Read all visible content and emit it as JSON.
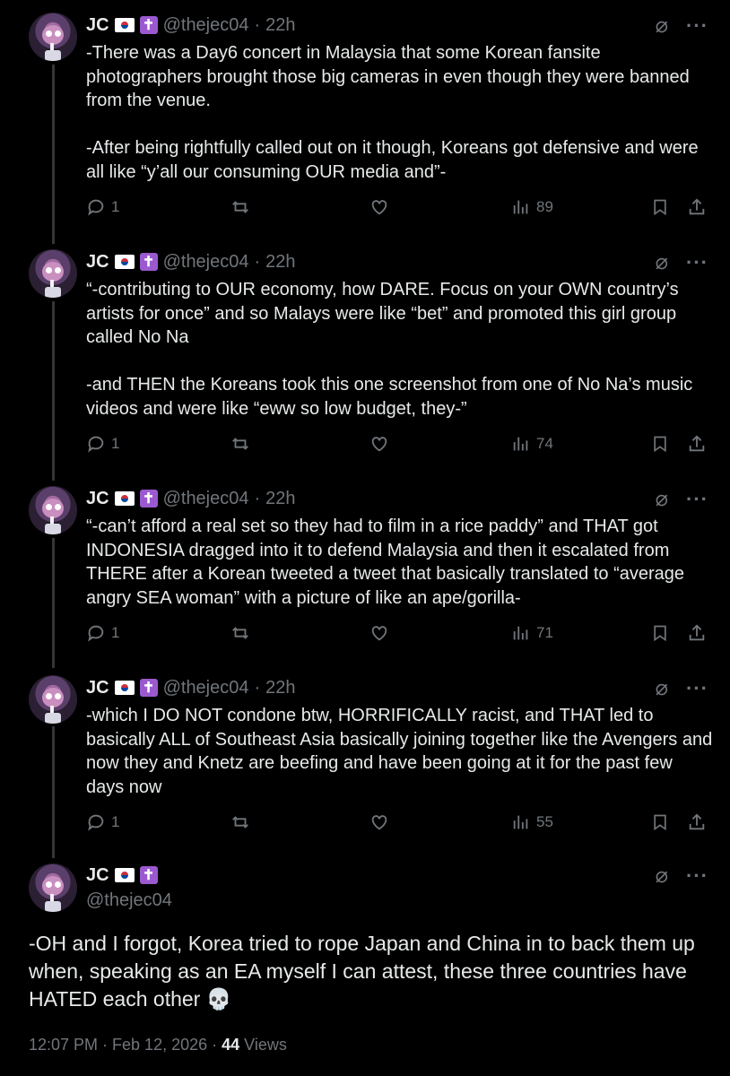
{
  "tweets": [
    {
      "name": "JC",
      "handle": "@thejec04",
      "dot": "·",
      "time": "22h",
      "text": "-There was a Day6 concert in Malaysia that some Korean fansite photographers brought those big cameras in even though they were banned from the venue.\n\n-After being rightfully called out on it though, Koreans got defensive and were all like “y’all our consuming OUR media and”-",
      "replies": "1",
      "views": "89"
    },
    {
      "name": "JC",
      "handle": "@thejec04",
      "dot": "·",
      "time": "22h",
      "text": "“-contributing to OUR economy, how DARE. Focus on your OWN country’s artists for once” and so Malays were like “bet” and promoted this girl group called No Na\n\n-and THEN the Koreans took this one screenshot from one of No Na’s music videos and were like “eww so low budget, they-”",
      "replies": "1",
      "views": "74"
    },
    {
      "name": "JC",
      "handle": "@thejec04",
      "dot": "·",
      "time": "22h",
      "text": "“-can’t afford a real set so they had to film in a rice paddy” and THAT got INDONESIA dragged into it to defend Malaysia and then it escalated from THERE after a Korean tweeted a tweet that basically translated to “average angry SEA woman” with a picture of like an ape/gorilla-",
      "replies": "1",
      "views": "71"
    },
    {
      "name": "JC",
      "handle": "@thejec04",
      "dot": "·",
      "time": "22h",
      "text": "-which I DO NOT condone btw, HORRIFICALLY racist, and THAT led to basically ALL of Southeast Asia basically joining together like the Avengers and now they and Knetz are beefing and have been going at it for the past few days now",
      "replies": "1",
      "views": "55"
    }
  ],
  "main": {
    "name": "JC",
    "handle": "@thejec04",
    "text": "-OH and I forgot, Korea tried to rope Japan and China in to back them up when, speaking as an EA myself I can attest, these three countries have HATED each other 💀",
    "timestamp": "12:07 PM · Feb 12, 2026 · ",
    "views_count": "44",
    "views_label": " Views"
  },
  "icons": [
    "grok-icon",
    "more-icon",
    "reply-icon",
    "retweet-icon",
    "like-icon",
    "views-icon",
    "bookmark-icon",
    "share-icon",
    "flag-kr-icon",
    "cross-icon"
  ],
  "colors": {
    "background": "#000000",
    "text": "#e7e9ea",
    "muted": "#71767b",
    "badge": "#9b59d0"
  }
}
